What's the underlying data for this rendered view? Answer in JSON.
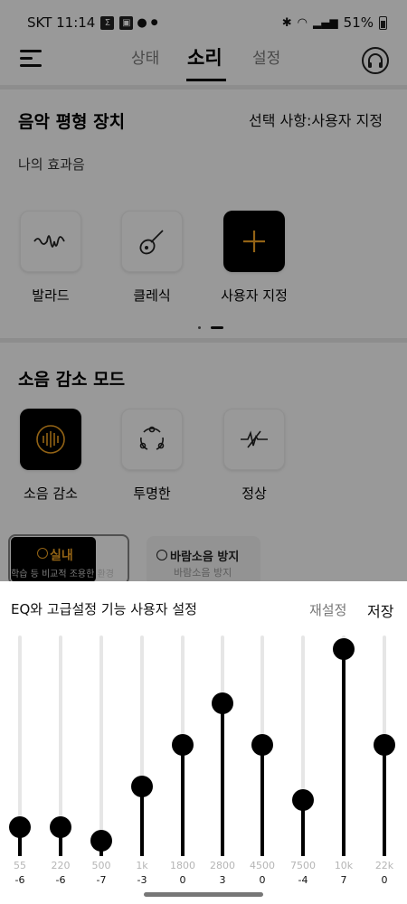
{
  "status_bar": {
    "carrier_time": "SKT 11:14",
    "battery": "51%"
  },
  "header": {
    "tabs": [
      "상태",
      "소리",
      "설정"
    ],
    "active_tab": "소리"
  },
  "equalizer": {
    "title": "음악 평형 장치",
    "selection": "선택 사항:사용자 지정",
    "my_effects_label": "나의 효과음",
    "presets": [
      {
        "label": "발라드",
        "icon": "waveform-icon"
      },
      {
        "label": "클레식",
        "icon": "guitar-icon"
      },
      {
        "label": "사용자 지정",
        "icon": "plus-icon",
        "selected": true
      }
    ]
  },
  "noise": {
    "title": "소음 감소 모드",
    "modes": [
      {
        "label": "소음 감소",
        "icon": "noise-cancel-icon",
        "selected": true
      },
      {
        "label": "투명한",
        "icon": "transparency-icon"
      },
      {
        "label": "정상",
        "icon": "normal-icon"
      }
    ],
    "sub_modes": [
      {
        "title": "실내",
        "desc": "학습 등 비교적 조용한 환경",
        "selected": true
      },
      {
        "title": "바람소음 방지",
        "desc": "바람소음 방지"
      }
    ]
  },
  "eq_sheet": {
    "title": "EQ와 고급설정 기능 사용자 설정",
    "reset": "재설정",
    "save": "저장",
    "bands": [
      {
        "freq": "55",
        "gain": -6
      },
      {
        "freq": "220",
        "gain": -6
      },
      {
        "freq": "500",
        "gain": -7
      },
      {
        "freq": "1k",
        "gain": -3
      },
      {
        "freq": "1800",
        "gain": 0
      },
      {
        "freq": "2800",
        "gain": 3
      },
      {
        "freq": "4500",
        "gain": 0
      },
      {
        "freq": "7500",
        "gain": -4
      },
      {
        "freq": "10k",
        "gain": 7
      },
      {
        "freq": "22k",
        "gain": 0
      }
    ]
  },
  "colors": {
    "accent": "#f5a623",
    "overlay": "rgba(0,0,0,0.40)"
  }
}
